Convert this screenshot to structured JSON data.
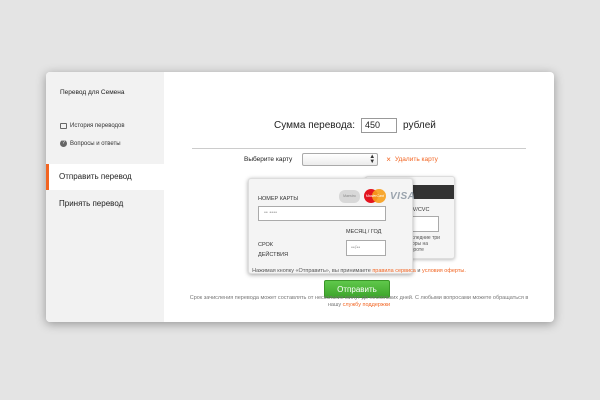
{
  "sidebar": {
    "title": "Перевод для Семена",
    "links": [
      {
        "label": "История переводов",
        "icon": "history-icon"
      },
      {
        "label": "Вопросы и ответы",
        "icon": "question-icon"
      }
    ],
    "tabs": [
      {
        "label": "Отправить перевод",
        "active": true
      },
      {
        "label": "Принять перевод",
        "active": false
      }
    ]
  },
  "amount": {
    "label": "Сумма перевода:",
    "value": "450",
    "currency": "рублей"
  },
  "card_select": {
    "label": "Выберите карту",
    "selected": "",
    "delete_label": "Удалить карту"
  },
  "card_front": {
    "number_label": "НОМЕР КАРТЫ",
    "number_placeholder": "•• ••••",
    "expiry_label_1": "СРОК",
    "expiry_label_2": "ДЕЙСТВИЯ",
    "month_label": "МЕСЯЦ / ГОД",
    "month_placeholder": "••/••",
    "logos": {
      "maestro": "Maestro",
      "mastercard": "MasterCard",
      "visa": "VISA"
    }
  },
  "card_back": {
    "cvv_label": "CVV/CVC",
    "cvv_note": "Последние три цифры на обороте"
  },
  "terms": {
    "prefix": "Нажимая кнопку «Отправить», вы принимаете",
    "link1": "правила сервиса",
    "and": "и",
    "link2": "условия оферты."
  },
  "send_button": "Отправить",
  "note": {
    "text": "Срок зачисления перевода может составлять от нескольких минут до нескольких дней. С любыми вопросами можете обращаться в нашу",
    "link": "службу поддержки"
  },
  "colors": {
    "accent": "#f26522",
    "button": "#4cb83a"
  }
}
